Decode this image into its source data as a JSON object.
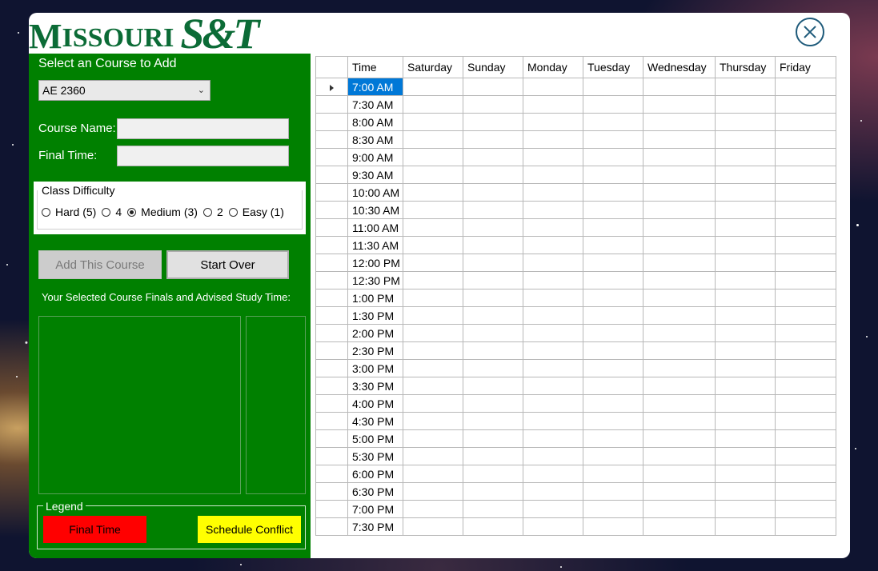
{
  "logo": {
    "word1": "M",
    "word2": "ISSOURI",
    "word3": "S&T"
  },
  "left_panel": {
    "select_label": "Select an Course to Add",
    "selected_course": "AE 2360",
    "course_name_label": "Course Name:",
    "course_name_value": "",
    "final_time_label": "Final Time:",
    "final_time_value": "",
    "difficulty": {
      "title": "Class Difficulty",
      "options": [
        "Hard (5)",
        "4",
        "Medium (3)",
        "2",
        "Easy (1)"
      ],
      "selected_index": 2
    },
    "add_button": "Add This Course",
    "start_over_button": "Start Over",
    "selected_finals_label": "Your Selected Course Finals and Advised Study Time:",
    "legend": {
      "title": "Legend",
      "final_time": "Final Time",
      "schedule_conflict": "Schedule Conflict"
    }
  },
  "colors": {
    "panel_green": "#008000",
    "logo_green": "#0b6b36",
    "final_time_red": "#ff0000",
    "conflict_yellow": "#ffff00",
    "selection_blue": "#0078d7"
  },
  "schedule": {
    "headers": [
      "Time",
      "Saturday",
      "Sunday",
      "Monday",
      "Tuesday",
      "Wednesday",
      "Thursday",
      "Friday"
    ],
    "times": [
      "7:00 AM",
      "7:30 AM",
      "8:00 AM",
      "8:30 AM",
      "9:00 AM",
      "9:30 AM",
      "10:00 AM",
      "10:30 AM",
      "11:00 AM",
      "11:30 AM",
      "12:00 PM",
      "12:30 PM",
      "1:00 PM",
      "1:30 PM",
      "2:00 PM",
      "2:30 PM",
      "3:00 PM",
      "3:30 PM",
      "4:00 PM",
      "4:30 PM",
      "5:00 PM",
      "5:30 PM",
      "6:00 PM",
      "6:30 PM",
      "7:00 PM",
      "7:30 PM"
    ],
    "selected_row": 0
  },
  "icons": {
    "close": "close-circle-icon",
    "row_pointer": "row-pointer-icon",
    "dropdown": "chevron-down-icon"
  }
}
